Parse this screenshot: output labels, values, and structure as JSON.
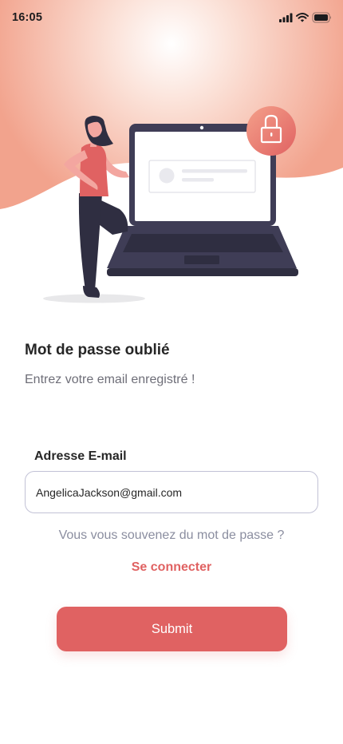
{
  "status_bar": {
    "time": "16:05",
    "icons": [
      "signal-icon",
      "wifi-icon",
      "battery-icon"
    ]
  },
  "illustration": {
    "name": "forgot-password-illustration",
    "icons": [
      "lock-icon",
      "laptop-icon"
    ]
  },
  "main": {
    "title": "Mot de passe oublié",
    "subtitle": "Entrez votre email enregistré !"
  },
  "form": {
    "email_label": "Adresse E-mail",
    "email_value": "AngelicaJackson@gmail.com"
  },
  "footer": {
    "remember_text": "Vous vous souvenez du mot de passe ?",
    "login_link": "Se connecter",
    "submit_label": "Submit"
  },
  "colors": {
    "accent": "#e06262",
    "title_text": "#262626",
    "muted_text": "#8b8ea0",
    "hero_peach": "#f2a38d"
  }
}
